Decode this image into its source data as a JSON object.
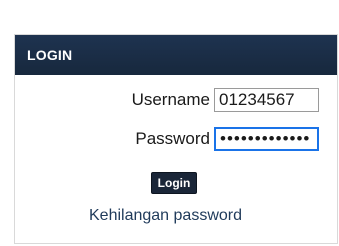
{
  "login": {
    "header": "LOGIN",
    "username_label": "Username",
    "username_value": "01234567",
    "password_label": "Password",
    "password_value": "•••••••••••••",
    "button_label": "Login",
    "forgot_link": "Kehilangan password"
  },
  "colors": {
    "header_bg": "#1b2d45",
    "button_bg": "#1a2638",
    "focus_border": "#1a73e8"
  }
}
